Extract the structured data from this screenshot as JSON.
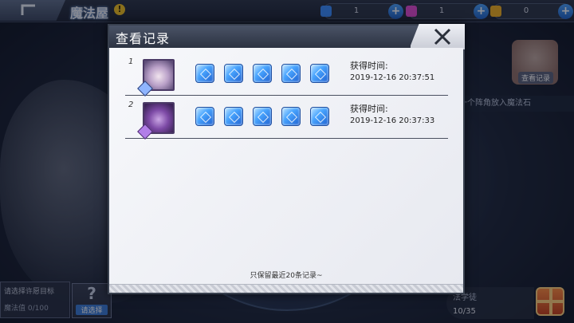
{
  "header": {
    "title": "魔法屋",
    "alert": "!",
    "resources": [
      {
        "icon": "blue-crystal-icon",
        "value": "1",
        "color": "#3a8cff"
      },
      {
        "icon": "pink-crystal-icon",
        "value": "1",
        "color": "#e04ad0"
      },
      {
        "icon": "gold-coin-icon",
        "value": "0",
        "color": "#f0b020"
      }
    ]
  },
  "background": {
    "record_button": "查看记录",
    "hint": "择一个阵角放入魔法石",
    "wish_target": "请选择许愿目标",
    "magic_value": "魔法值 0/100",
    "select_button": "请选择",
    "q_mark": "?",
    "magic_study": "法学徒",
    "progress": "10/35"
  },
  "dialog": {
    "title": "查看记录",
    "footer_note": "只保留最近20条记录~",
    "records": [
      {
        "index": "1",
        "time_label": "获得时间:",
        "time": "2019-12-16 20:37:51",
        "gems": 5
      },
      {
        "index": "2",
        "time_label": "获得时间:",
        "time": "2019-12-16 20:37:33",
        "gems": 5
      }
    ]
  },
  "colors": {
    "gem_blue": "#4aa6ff",
    "dialog_header": "#2c3342",
    "dialog_bg": "#f4f5f9"
  }
}
